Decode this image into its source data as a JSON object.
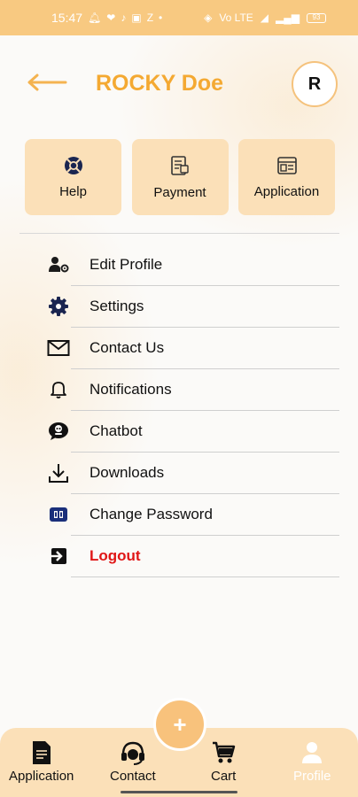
{
  "status_bar": {
    "time": "15:47",
    "notif_icons": [
      "bell-icon",
      "heart-icon",
      "music-icon",
      "app-icon",
      "z-icon",
      "dot-icon"
    ],
    "z_text": "Z",
    "battery": "93",
    "net_label": "Vo LTE"
  },
  "header": {
    "title": "ROCKY Doe",
    "avatar_initial": "R",
    "accent_color": "#f4a932"
  },
  "quick_actions": [
    {
      "label": "Help",
      "icon": "lifebuoy-icon"
    },
    {
      "label": "Payment",
      "icon": "receipt-icon"
    },
    {
      "label": "Application",
      "icon": "window-icon"
    }
  ],
  "menu": [
    {
      "label": "Edit Profile",
      "icon": "user-gear-icon"
    },
    {
      "label": "Settings",
      "icon": "gear-icon"
    },
    {
      "label": "Contact Us",
      "icon": "mail-icon"
    },
    {
      "label": "Notifications",
      "icon": "bell-icon"
    },
    {
      "label": "Chatbot",
      "icon": "chatbot-icon"
    },
    {
      "label": "Downloads",
      "icon": "download-icon"
    },
    {
      "label": "Change Password",
      "icon": "key-icon"
    },
    {
      "label": "Logout",
      "icon": "logout-icon",
      "color": "#e01616"
    }
  ],
  "bottom_nav": {
    "items": [
      {
        "label": "Application",
        "icon": "document-icon"
      },
      {
        "label": "Contact",
        "icon": "headset-icon"
      },
      {
        "label": "Cart",
        "icon": "cart-icon"
      },
      {
        "label": "Profile",
        "icon": "person-icon",
        "active": true
      }
    ],
    "fab_label": "+"
  }
}
